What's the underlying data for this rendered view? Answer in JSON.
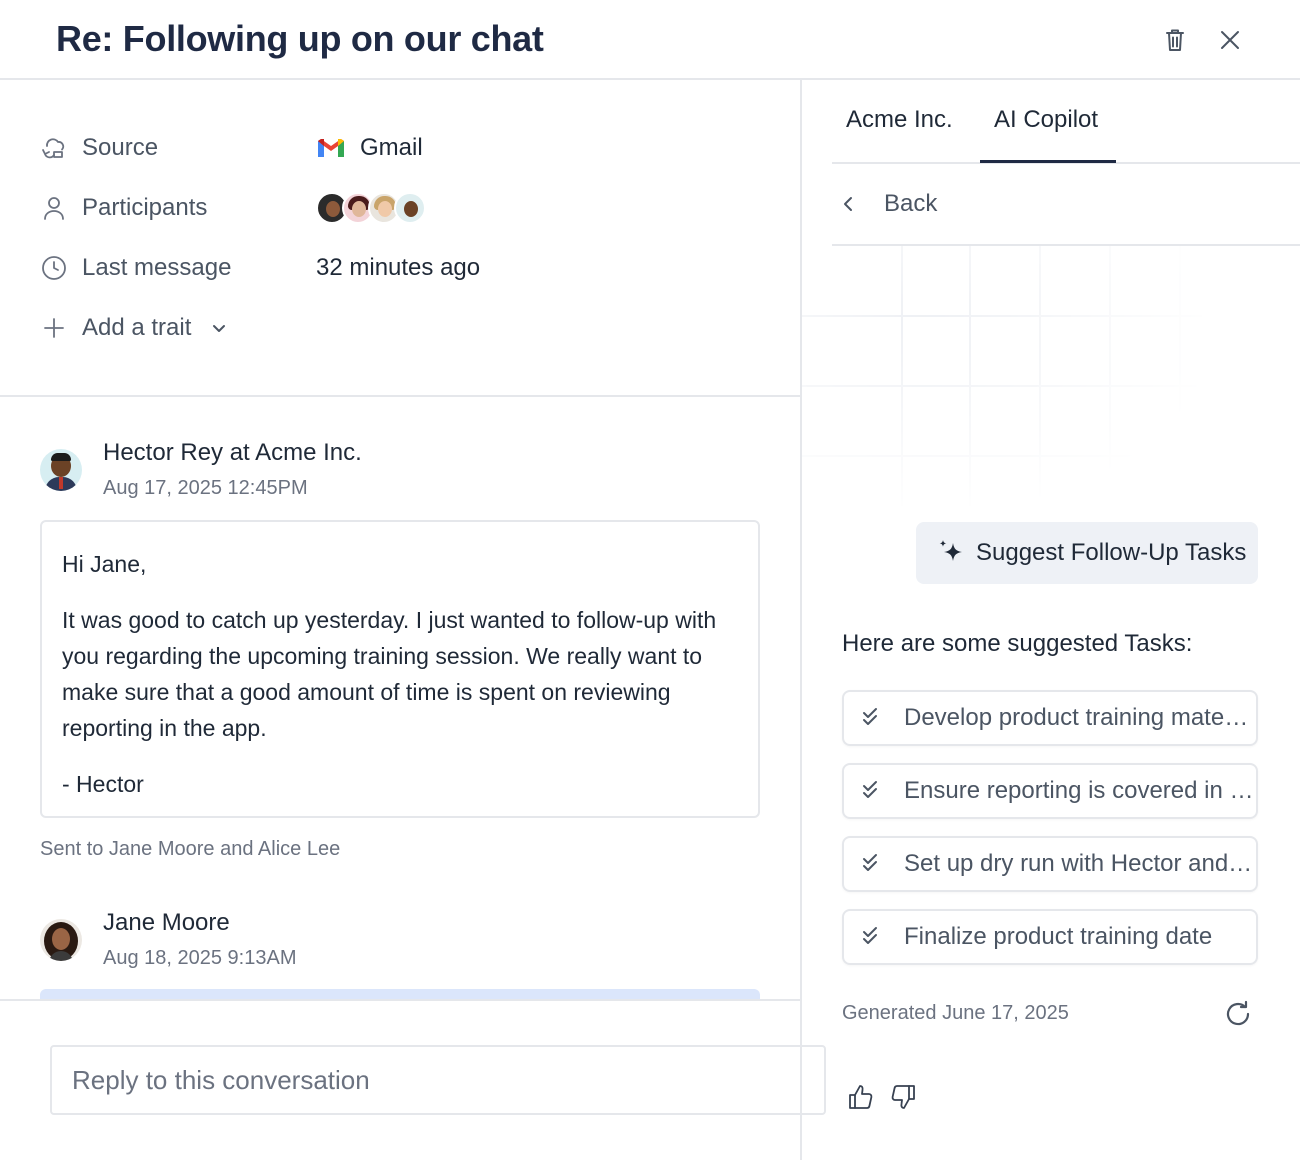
{
  "header": {
    "title": "Re: Following up on our chat",
    "delete_icon": "trash-icon",
    "close_icon": "close-icon"
  },
  "traits": {
    "source": {
      "label": "Source",
      "value": "Gmail",
      "icon": "sync-cloud-icon"
    },
    "participants": {
      "label": "Participants",
      "icon": "user-icon"
    },
    "last_message": {
      "label": "Last message",
      "value": "32 minutes ago",
      "icon": "clock-icon"
    },
    "add_trait": {
      "label": "Add a trait",
      "icon": "plus-icon"
    }
  },
  "messages": [
    {
      "author": "Hector Rey at Acme Inc.",
      "time": "Aug 17, 2025 12:45PM",
      "greeting": "Hi Jane,",
      "body": "It was good to catch up yesterday. I just wanted to follow-up with you regarding the upcoming training session. We really want to make sure that a good amount of time is spent on reviewing reporting in the app.",
      "signoff": "- Hector",
      "sent_to": "Sent to Jane Moore and Alice Lee"
    },
    {
      "author": "Jane Moore",
      "time": "Aug 18, 2025 9:13AM"
    }
  ],
  "reply": {
    "placeholder": "Reply to this conversation"
  },
  "panel": {
    "tabs": [
      "Acme Inc.",
      "AI Copilot"
    ],
    "active_tab": "AI Copilot",
    "back_label": "Back",
    "suggest_button": "Suggest Follow-Up Tasks",
    "suggestions_heading": "Here are some suggested Tasks:",
    "tasks": [
      "Develop product training materials",
      "Ensure reporting is covered in the session",
      "Set up dry run with Hector and Alice",
      "Finalize product training date"
    ],
    "generated": "Generated June 17, 2025"
  },
  "colors": {
    "title": "#1f2a44",
    "border": "#e5e7eb",
    "muted_text": "#6b7280",
    "suggest_bg": "#eef1f6",
    "next_message_bar": "#dbe6fb"
  }
}
